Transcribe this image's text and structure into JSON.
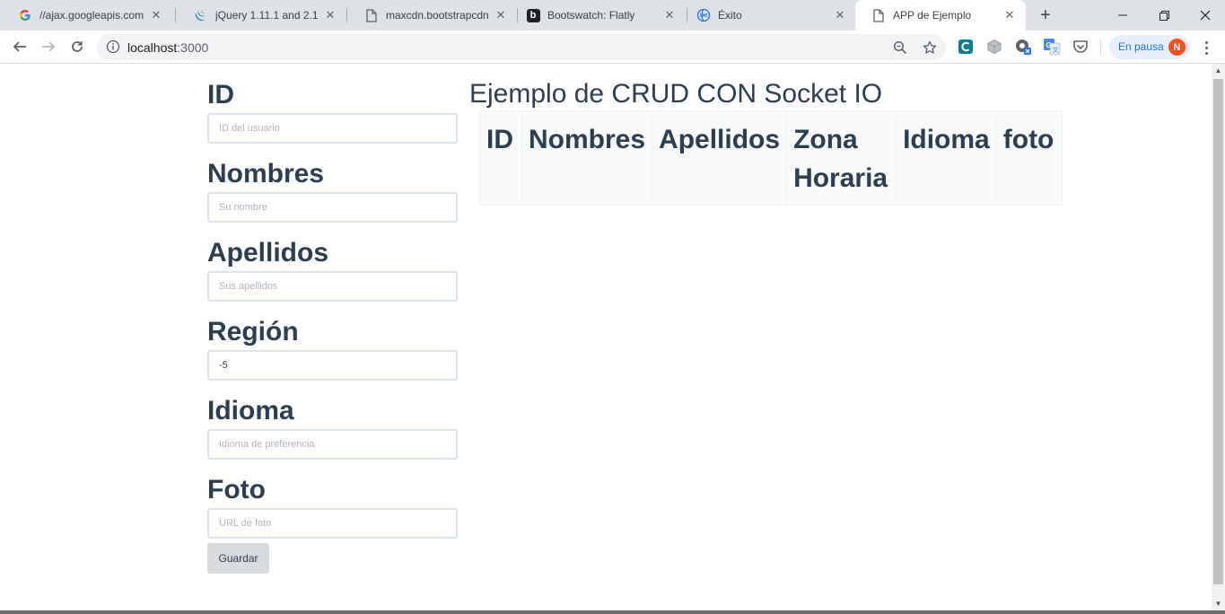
{
  "browser": {
    "tabs": [
      {
        "title": "//ajax.googleapis.com/a",
        "icon": "google-icon"
      },
      {
        "title": "jQuery 1.11.1 and 2.1.1",
        "icon": "jquery-icon"
      },
      {
        "title": "maxcdn.bootstrapcdn.c",
        "icon": "document-icon"
      },
      {
        "title": "Bootswatch: Flatly",
        "icon": "bootswatch-icon"
      },
      {
        "title": "Éxito",
        "icon": "globe-icon"
      },
      {
        "title": "APP de Ejemplo",
        "icon": "document-icon"
      }
    ],
    "url": "localhost",
    "url_port": ":3000",
    "profile_status": "En pausa",
    "profile_initial": "N"
  },
  "form": {
    "fields": [
      {
        "label": "ID",
        "placeholder": "ID del usuario",
        "value": ""
      },
      {
        "label": "Nombres",
        "placeholder": "Su nombre",
        "value": ""
      },
      {
        "label": "Apellidos",
        "placeholder": "Sus apellidos",
        "value": ""
      },
      {
        "label": "Región",
        "placeholder": "",
        "value": "-5"
      },
      {
        "label": "Idioma",
        "placeholder": "Idioma de preferencia",
        "value": ""
      },
      {
        "label": "Foto",
        "placeholder": "URL de foto",
        "value": ""
      }
    ],
    "submit_label": "Guardar"
  },
  "main": {
    "title": "Ejemplo de CRUD CON Socket IO",
    "table_headers": [
      "ID",
      "Nombres",
      "Apellidos",
      "Zona Horaria",
      "Idioma",
      "foto"
    ]
  },
  "colors": {
    "text": "#2c3e50",
    "input_border": "#dce4ec",
    "button_bg": "#d7dbdd",
    "table_header_bg": "#f8f9f9"
  }
}
